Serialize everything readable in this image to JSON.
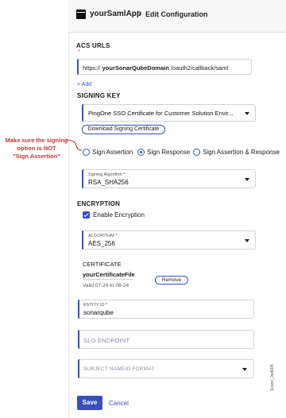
{
  "header": {
    "app_name": "yourSamlApp",
    "separator": ">",
    "page_title": "Edit Configuration"
  },
  "acs": {
    "label": "ACS URLS",
    "required_marker": "*",
    "url_prefix": "https://",
    "url_domain": "yourSonarQubeDomain",
    "url_path": "/oauth2/callback/saml",
    "add_label": "+ Add"
  },
  "signing_key": {
    "label": "SIGNING KEY",
    "value": "PingOne SSO Certificate for Customer Solution Envir...",
    "download_label": "Download Signing Certificate"
  },
  "signing_options": [
    {
      "label": "Sign Assertion",
      "selected": false
    },
    {
      "label": "Sign Response",
      "selected": true
    },
    {
      "label": "Sign Assertion & Response",
      "selected": false
    }
  ],
  "annotation": {
    "line1": "Make sure the signing",
    "line2": "option is NOT",
    "line3": "\"Sign Assertion\""
  },
  "signing_algorithm": {
    "label": "Signing Algorithm *",
    "value": "RSA_SHA256"
  },
  "encryption": {
    "label": "ENCRYPTION",
    "checkbox_label": "Enable Encryption",
    "algorithm_label": "ALGORITHM *",
    "algorithm_value": "AES_256"
  },
  "certificate": {
    "label": "CERTIFICATE",
    "file_name": "yourCertificateFile",
    "validity": "Valid 07-24 to 08-24",
    "remove_label": "Remove"
  },
  "entity_id": {
    "label": "ENTITY ID *",
    "value": "sonarqube"
  },
  "slo_endpoint": {
    "placeholder": "SLO ENDPOINT"
  },
  "subject_nameid_format": {
    "placeholder": "SUBJECT NAMEID FORMAT"
  },
  "actions": {
    "save_label": "Save",
    "cancel_label": "Cancel"
  },
  "side_id": "Scann_0ed004",
  "colors": {
    "accent": "#3a4fb8",
    "annotation": "#c0392b"
  }
}
